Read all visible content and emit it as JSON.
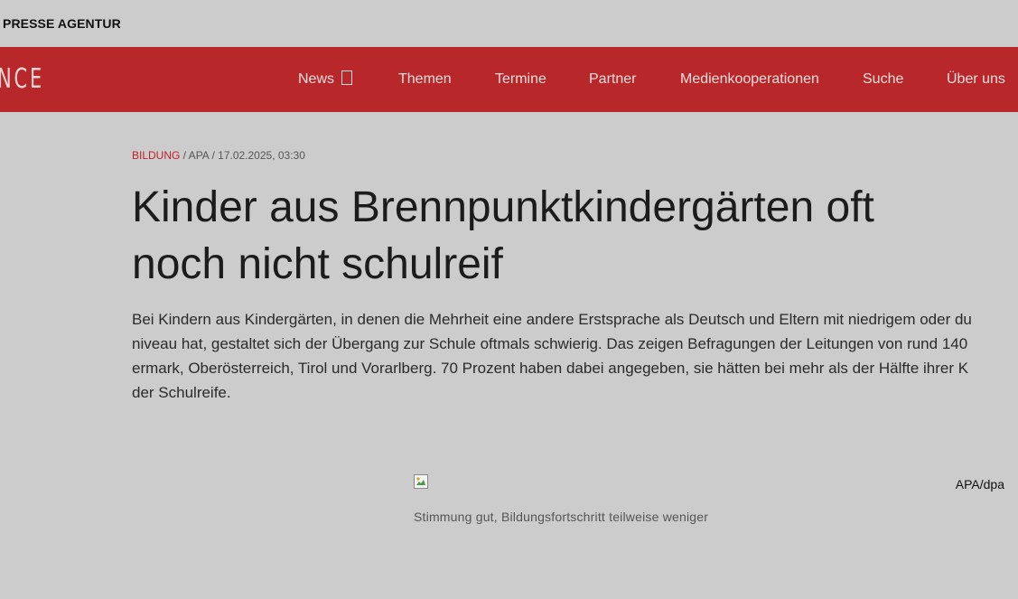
{
  "header": {
    "agency_name": "PRESSE AGENTUR",
    "logo_fragment": "NCE"
  },
  "nav": {
    "items": [
      {
        "label": "News",
        "has_dropdown": true
      },
      {
        "label": "Themen"
      },
      {
        "label": "Termine"
      },
      {
        "label": "Partner"
      },
      {
        "label": "Medienkooperationen"
      },
      {
        "label": "Suche"
      },
      {
        "label": "Über uns"
      }
    ]
  },
  "article": {
    "category": "BILDUNG",
    "meta_rest": " / APA / 17.02.2025, 03:30",
    "title_line1": "Kinder aus Brennpunktkindergärten oft",
    "title_line2": "noch nicht schulreif",
    "lead_lines": [
      "Bei Kindern aus Kindergärten, in denen die Mehrheit eine andere Erstsprache als Deutsch und Eltern mit niedrigem oder du",
      "niveau hat, gestaltet sich der Übergang zur Schule oftmals schwierig. Das zeigen Befragungen der Leitungen von rund 140",
      "ermark, Oberösterreich, Tirol und Vorarlberg. 70 Prozent haben dabei angegeben, sie hätten bei mehr als der Hälfte ihrer K",
      "der Schulreife."
    ],
    "image": {
      "credit": "APA/dpa",
      "caption": "Stimmung gut, Bildungsfortschritt teilweise weniger",
      "icon": "broken-image-icon"
    }
  },
  "colors": {
    "brand_red": "#b8272a",
    "background": "#cccccc",
    "category_red": "#c0202a"
  }
}
